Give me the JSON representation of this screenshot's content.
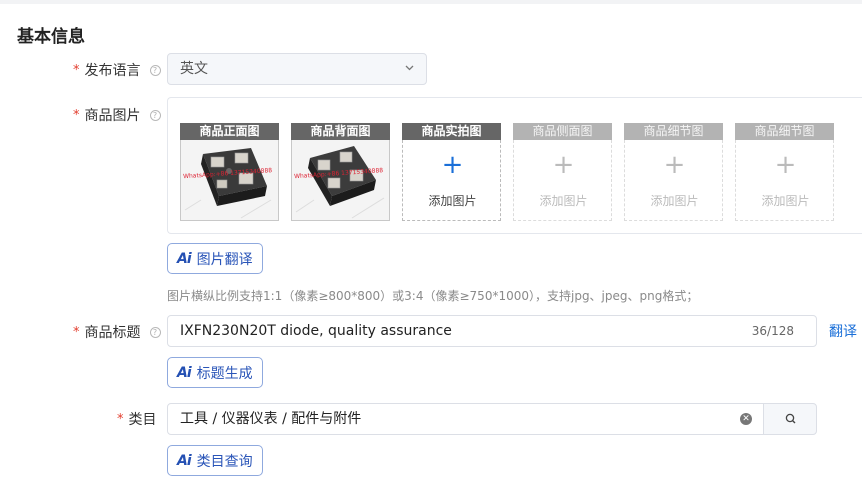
{
  "section": {
    "title": "基本信息"
  },
  "language": {
    "label": "发布语言",
    "value": "英文",
    "required_mark": "*"
  },
  "images": {
    "label": "商品图片",
    "required_mark": "*",
    "slots": [
      {
        "caption": "商品正面图",
        "state": "filled",
        "watermark": "WhatsApp:+86 13715340888"
      },
      {
        "caption": "商品背面图",
        "state": "filled",
        "watermark": "WhatsApp:+86 13715340888"
      },
      {
        "caption": "商品实拍图",
        "state": "empty",
        "add_text": "添加图片"
      },
      {
        "caption": "商品侧面图",
        "state": "disabled",
        "add_text": "添加图片"
      },
      {
        "caption": "商品细节图",
        "state": "disabled",
        "add_text": "添加图片"
      },
      {
        "caption": "商品细节图",
        "state": "disabled",
        "add_text": "添加图片"
      }
    ],
    "ai_button": "图片翻译",
    "hint": "图片横纵比例支持1:1（像素≥800*800）或3:4（像素≥750*1000），支持jpg、jpeg、png格式；"
  },
  "product_title": {
    "label": "商品标题",
    "required_mark": "*",
    "value": "IXFN230N20T diode, quality assurance",
    "counter": "36/128",
    "translate_link": "翻译",
    "ai_button": "标题生成"
  },
  "category": {
    "label": "类目",
    "required_mark": "*",
    "value": "工具 / 仪器仪表 / 配件与附件",
    "ai_button": "类目查询"
  },
  "ai_icon_text": "Ai",
  "colors": {
    "accent": "#1a6fd8",
    "required": "#e23c2c",
    "ai_border": "#8fa9de"
  }
}
